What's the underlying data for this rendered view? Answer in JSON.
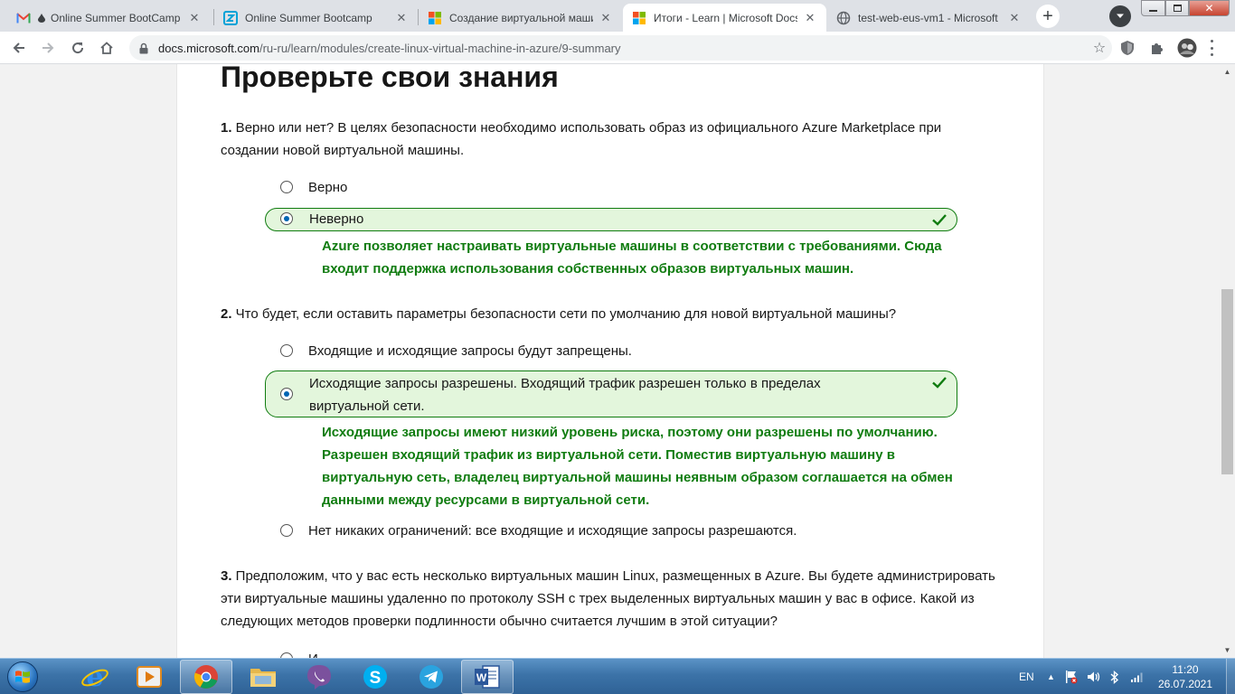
{
  "browser": {
    "tabs": [
      {
        "title": "Online Summer BootCamp",
        "icon": "gmail-icon"
      },
      {
        "title": "Online Summer Bootcamp",
        "icon": "zoom-z-icon"
      },
      {
        "title": "Создание виртуальной маши",
        "icon": "microsoft-icon"
      },
      {
        "title": "Итоги - Learn | Microsoft Docs",
        "icon": "microsoft-icon"
      },
      {
        "title": "test-web-eus-vm1 - Microsoft",
        "icon": "globe-icon"
      }
    ],
    "active_tab": 3,
    "url_host": "docs.microsoft.com",
    "url_path": "/ru-ru/learn/modules/create-linux-virtual-machine-in-azure/9-summary"
  },
  "page": {
    "heading": "Проверьте свои знания",
    "q1": {
      "num": "1.",
      "text": " Верно или нет? В целях безопасности необходимо использовать образ из официального Azure Marketplace при создании новой виртуальной машины.",
      "options": [
        "Верно",
        "Неверно"
      ],
      "explanation": "Azure позволяет настраивать виртуальные машины в соответствии с требованиями. Сюда входит поддержка использования собственных образов виртуальных машин."
    },
    "q2": {
      "num": "2.",
      "text": " Что будет, если оставить параметры безопасности сети по умолчанию для новой виртуальной машины?",
      "options": [
        "Входящие и исходящие запросы будут запрещены.",
        "Исходящие запросы разрешены. Входящий трафик разрешен только в пределах виртуальной сети.",
        "Нет никаких ограничений: все входящие и исходящие запросы разрешаются."
      ],
      "explanation": "Исходящие запросы имеют низкий уровень риска, поэтому они разрешены по умолчанию. Разрешен входящий трафик из виртуальной сети. Поместив виртуальную машину в виртуальную сеть, владелец виртуальной машины неявным образом соглашается на обмен данными между ресурсами в виртуальной сети."
    },
    "q3": {
      "num": "3.",
      "text": " Предположим, что у вас есть несколько виртуальных машин Linux, размещенных в Azure. Вы будете администрировать эти виртуальные машины удаленно по протоколу SSH с трех выделенных виртуальных машин у вас в офисе. Какой из следующих методов проверки подлинности обычно считается лучшим в этой ситуации?",
      "first_option_partial": "И"
    }
  },
  "taskbar": {
    "apps": [
      "internet-explorer-icon",
      "media-player-icon",
      "chrome-icon",
      "file-explorer-icon",
      "viber-icon",
      "skype-icon",
      "telegram-icon",
      "word-icon"
    ],
    "language": "EN",
    "time": "11:20",
    "date": "26.07.2021"
  },
  "colors": {
    "correct_green": "#107c10",
    "correct_bg": "#e3f6dc",
    "radio_blue": "#0065b3"
  }
}
